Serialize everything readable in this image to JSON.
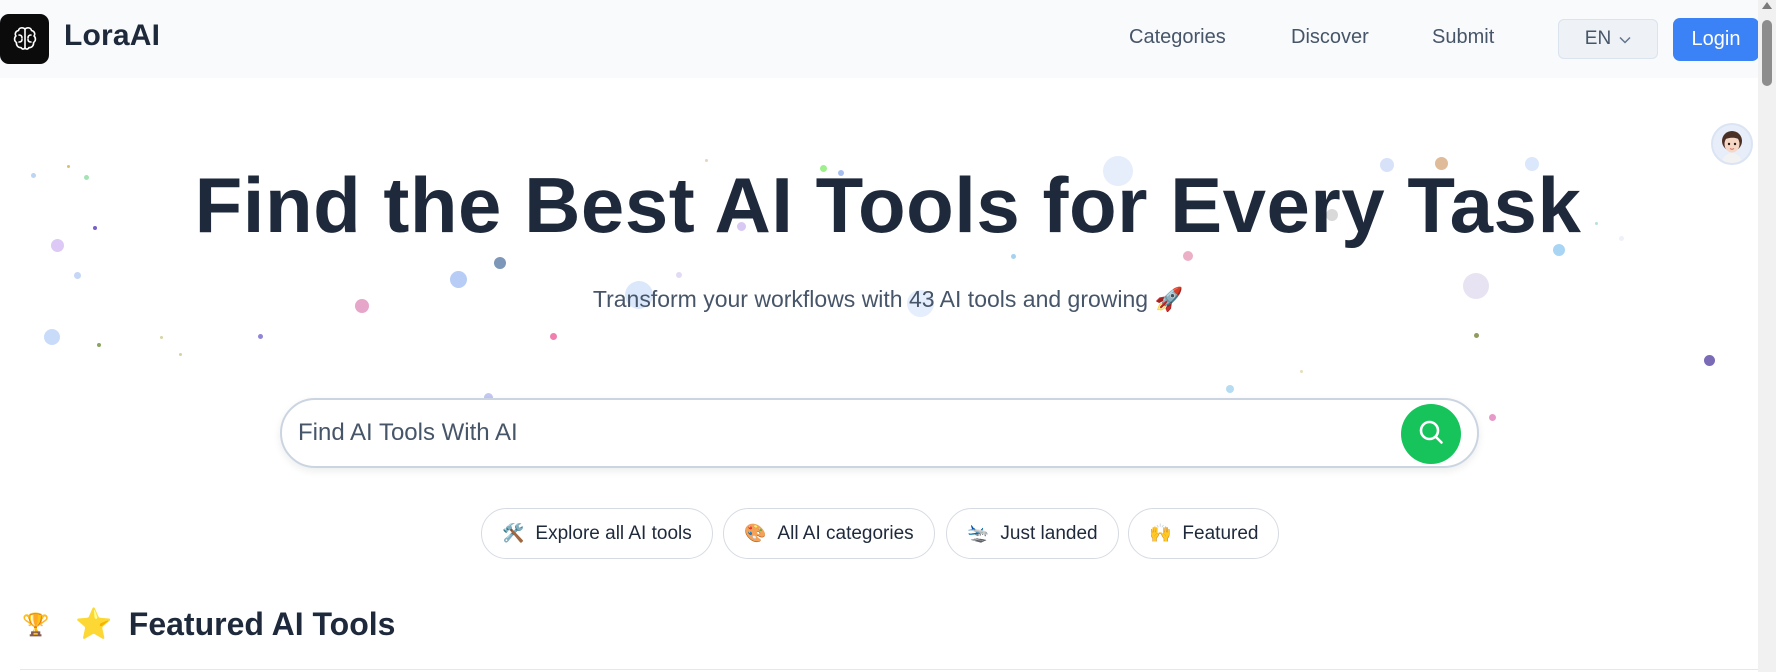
{
  "header": {
    "brand": "LoraAI",
    "nav": [
      "Categories",
      "Discover",
      "Submit"
    ],
    "language": "EN",
    "login_label": "Login"
  },
  "hero": {
    "title": "Find the Best AI Tools for Every Task",
    "subtitle": "Transform your workflows with 43 AI tools and growing 🚀"
  },
  "search": {
    "placeholder": "Find AI Tools With AI"
  },
  "chips": [
    {
      "emoji": "🛠️",
      "label": "Explore all AI tools"
    },
    {
      "emoji": "🎨",
      "label": "All AI categories"
    },
    {
      "emoji": "🛬",
      "label": "Just landed"
    },
    {
      "emoji": "🙌",
      "label": "Featured"
    }
  ],
  "featured": {
    "trophy": "🏆",
    "star": "⭐",
    "title": "Featured AI Tools"
  },
  "colors": {
    "accent": "#3b82f6",
    "search_button": "#16c45b",
    "text": "#1e293b"
  }
}
